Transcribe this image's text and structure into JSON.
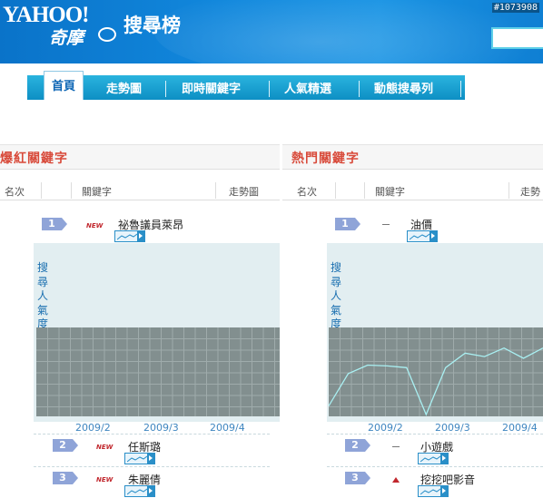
{
  "header": {
    "logo_text": "YAHOO!",
    "logo_sub": "奇摩",
    "site_title": "搜尋榜",
    "photo_id": "#1073908"
  },
  "nav": {
    "tabs": [
      {
        "label": "首頁",
        "active": true
      },
      {
        "label": "走勢圖",
        "active": false
      },
      {
        "label": "即時關鍵字",
        "active": false
      },
      {
        "label": "人氣精選",
        "active": false
      },
      {
        "label": "動態搜尋列",
        "active": false
      }
    ]
  },
  "panels": [
    {
      "title": "爆紅關鍵字",
      "columns": {
        "rank": "名次",
        "keyword": "關鍵字",
        "trend": "走勢圖"
      },
      "chart": {
        "ylabel": "搜尋人氣度",
        "xlabels": [
          "2009/2",
          "2009/3",
          "2009/4"
        ]
      },
      "items": [
        {
          "rank": "1",
          "status": "NEW",
          "keyword": "祕魯議員萊昂"
        },
        {
          "rank": "2",
          "status": "NEW",
          "keyword": "任斯璐"
        },
        {
          "rank": "3",
          "status": "NEW",
          "keyword": "朱麗倩"
        }
      ]
    },
    {
      "title": "熱門關鍵字",
      "columns": {
        "rank": "名次",
        "keyword": "關鍵字",
        "trend": "走勢"
      },
      "chart": {
        "ylabel": "搜尋人氣度",
        "xlabels": [
          "2009/2",
          "2009/3",
          "2009/4"
        ]
      },
      "items": [
        {
          "rank": "1",
          "status": "same",
          "keyword": "油價"
        },
        {
          "rank": "2",
          "status": "same",
          "keyword": "小遊戲"
        },
        {
          "rank": "3",
          "status": "up",
          "keyword": "挖挖吧影音"
        }
      ]
    }
  ],
  "chart_data": {
    "type": "line",
    "title": "",
    "xlabel": "",
    "ylabel": "搜尋人氣度",
    "x": [
      "2009/2",
      "2009/3",
      "2009/4"
    ],
    "series": [
      {
        "values": [
          10,
          48,
          58,
          57,
          55,
          0,
          55,
          72,
          68,
          78,
          66,
          78
        ]
      }
    ],
    "ylim": [
      0,
      100
    ],
    "grid": true
  }
}
